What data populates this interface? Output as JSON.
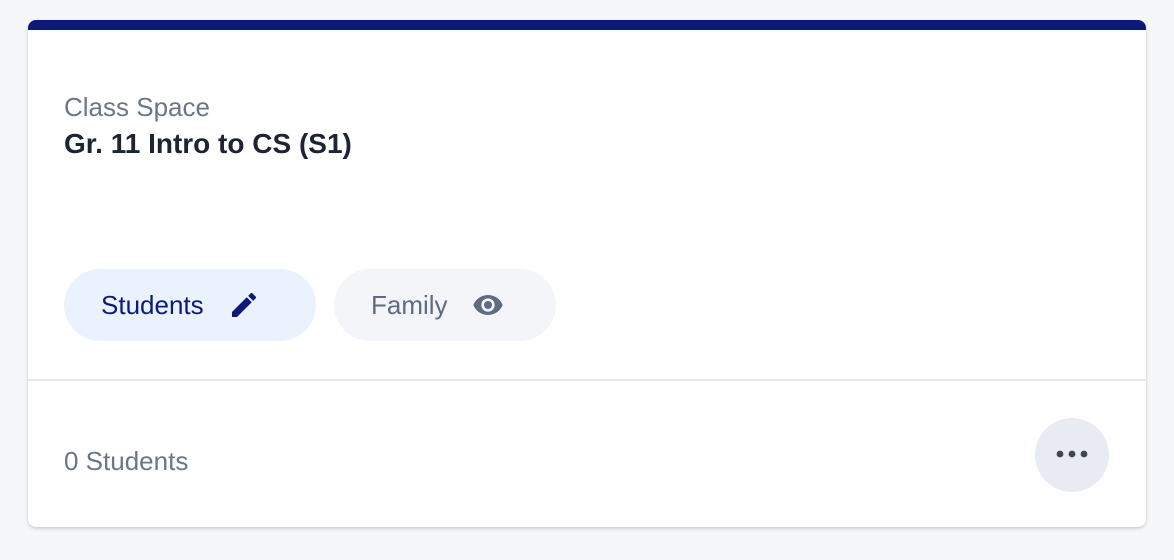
{
  "card": {
    "eyebrow": "Class Space",
    "title": "Gr. 11 Intro to CS (S1)",
    "accent_color": "#0d1a7a"
  },
  "chips": [
    {
      "label": "Students",
      "icon": "pencil-icon",
      "state": "editable"
    },
    {
      "label": "Family",
      "icon": "eye-icon",
      "state": "view-only"
    }
  ],
  "footer": {
    "count_label": "0 Students",
    "more_icon": "more-horizontal-icon"
  }
}
